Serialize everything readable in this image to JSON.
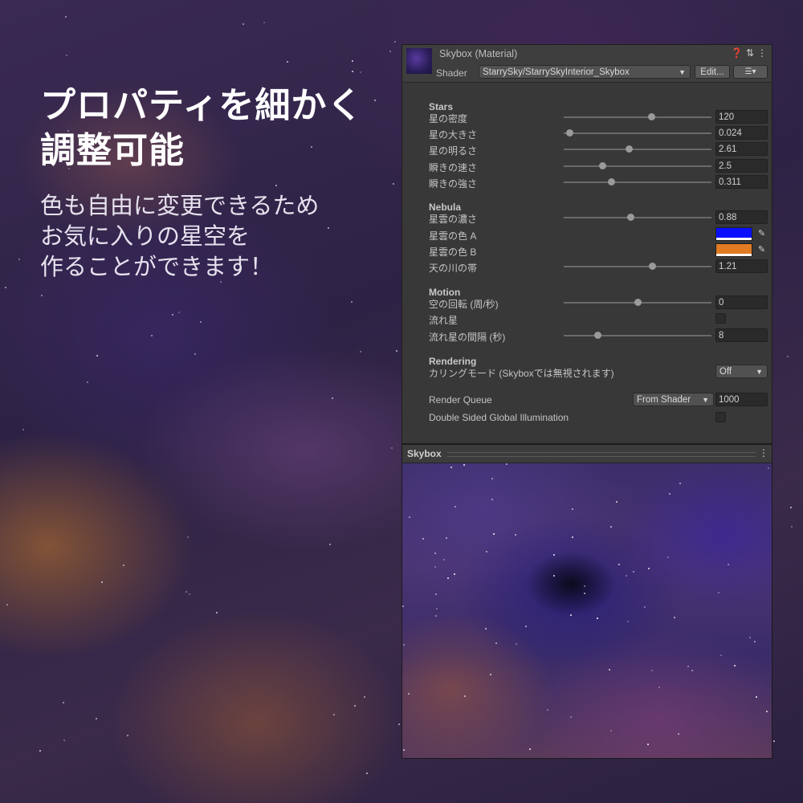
{
  "promo": {
    "headline": [
      "プロパティを細かく",
      "調整可能"
    ],
    "subcopy": [
      "色も自由に変更できるため",
      "お気に入りの星空を",
      "作ることができます！"
    ]
  },
  "inspector": {
    "material_title": "Skybox (Material)",
    "header_icons": [
      "help-icon",
      "settings-sliders-icon",
      "more-vertical-icon"
    ],
    "shader_label": "Shader",
    "shader_value": "StarrySky/StarrySkyInterior_Skybox",
    "edit_button": "Edit...",
    "list_button": "☰▾",
    "sections": {
      "stars": {
        "title": "Stars",
        "props": [
          {
            "label": "星の密度",
            "value": "120",
            "slider": 0.59
          },
          {
            "label": "星の大きさ",
            "value": "0.024",
            "slider": 0.04
          },
          {
            "label": "星の明るさ",
            "value": "2.61",
            "slider": 0.44
          },
          {
            "label": "瞬きの速さ",
            "value": "2.5",
            "slider": 0.26
          },
          {
            "label": "瞬きの強さ",
            "value": "0.311",
            "slider": 0.32
          }
        ]
      },
      "nebula": {
        "title": "Nebula",
        "density": {
          "label": "星雲の濃さ",
          "value": "0.88",
          "slider": 0.45
        },
        "color_a": {
          "label": "星雲の色 A",
          "color": "#0a10ff"
        },
        "color_b": {
          "label": "星雲の色 B",
          "color": "#e07b22"
        },
        "milky": {
          "label": "天の川の帯",
          "value": "1.21",
          "slider": 0.6
        }
      },
      "motion": {
        "title": "Motion",
        "rotation": {
          "label": "空の回転 (周/秒)",
          "value": "0",
          "slider": 0.5
        },
        "shooting": {
          "label": "流れ星",
          "checked": false
        },
        "interval": {
          "label": "流れ星の間隔 (秒)",
          "value": "8",
          "slider": 0.23
        }
      },
      "rendering": {
        "title": "Rendering",
        "culling": {
          "label": "カリングモード (Skyboxでは無視されます)",
          "value": "Off"
        }
      }
    },
    "render_queue": {
      "label": "Render Queue",
      "mode": "From Shader",
      "value": "1000"
    },
    "double_sided_gi": {
      "label": "Double Sided Global Illumination",
      "checked": false
    }
  },
  "preview": {
    "title": "Skybox"
  }
}
